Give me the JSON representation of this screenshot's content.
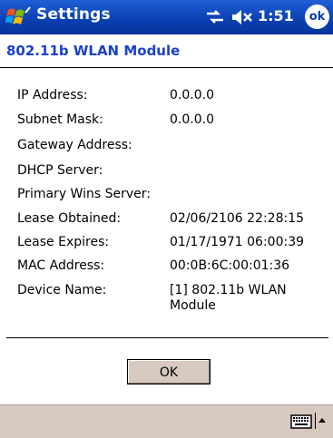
{
  "title_bar": {
    "app_title": "Settings",
    "time": "1:51",
    "ok_label": "ok",
    "colors": {
      "background": "#0a3fb0",
      "text": "#ffffff"
    }
  },
  "header": {
    "title": "802.11b WLAN Module",
    "color": "#1b3fcf"
  },
  "fields": {
    "ip_address": {
      "label": "IP Address:",
      "value": "0.0.0.0"
    },
    "subnet_mask": {
      "label": "Subnet Mask:",
      "value": "0.0.0.0"
    },
    "gateway_address": {
      "label": "Gateway Address:",
      "value": ""
    },
    "dhcp_server": {
      "label": "DHCP Server:",
      "value": ""
    },
    "primary_wins_server": {
      "label": "Primary Wins Server:",
      "value": ""
    },
    "lease_obtained": {
      "label": "Lease Obtained:",
      "value": "02/06/2106 22:28:15"
    },
    "lease_expires": {
      "label": "Lease Expires:",
      "value": "01/17/1971 06:00:39"
    },
    "mac_address": {
      "label": "MAC Address:",
      "value": "00:0B:6C:00:01:36"
    },
    "device_name": {
      "label": "Device Name:",
      "value_line1": "[1] 802.11b WLAN",
      "value_line2": "Module"
    }
  },
  "buttons": {
    "ok": "OK"
  },
  "menu_bar": {
    "icons": [
      "keyboard-icon",
      "input-arrow-icon"
    ],
    "background": "#d8c9c0"
  }
}
